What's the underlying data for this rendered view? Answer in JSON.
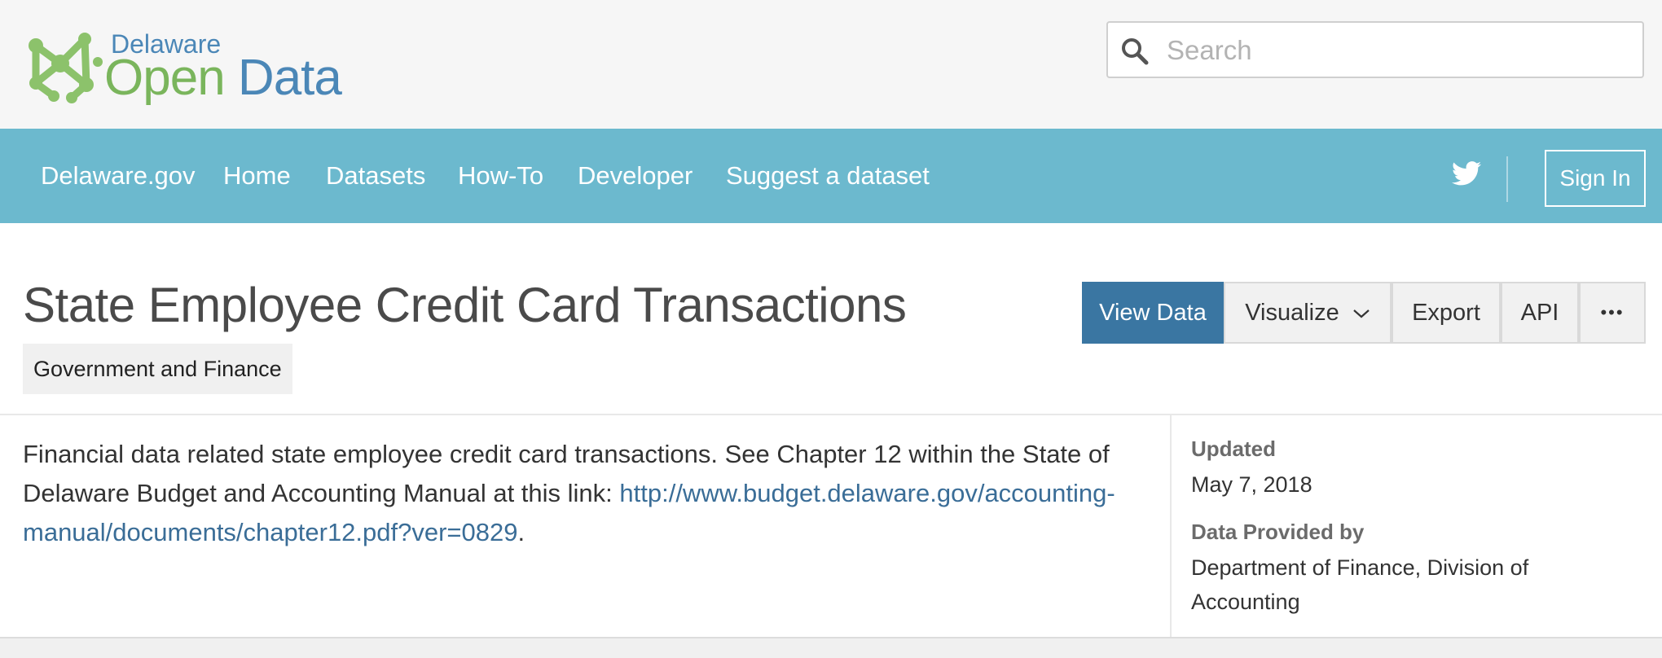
{
  "logo": {
    "small_text": "Delaware",
    "big_text_o": "O",
    "big_text_pen": "pen",
    "big_text_data": " Data",
    "colors": {
      "green": "#7ab55c",
      "blue": "#4b87b7"
    }
  },
  "search": {
    "placeholder": "Search",
    "value": ""
  },
  "nav": {
    "items": [
      "Delaware.gov",
      "Home",
      "Datasets",
      "How-To",
      "Developer",
      "Suggest a dataset"
    ],
    "sign_in": "Sign In",
    "background": "#6cb9ce"
  },
  "dataset": {
    "title": "State Employee Credit Card Transactions",
    "category": "Government and Finance",
    "actions": {
      "view_data": "View Data",
      "visualize": "Visualize",
      "export": "Export",
      "api": "API",
      "more": "•••"
    },
    "description_text": "Financial data related state employee credit card transactions. See Chapter 12 within the State of Delaware Budget and Accounting Manual at this link: ",
    "description_link": "http://www.budget.delaware.gov/accounting-manual/documents/chapter12.pdf?ver=0829",
    "description_end": "."
  },
  "meta": {
    "updated_label": "Updated",
    "updated_value": "May 7, 2018",
    "provider_label": "Data Provided by",
    "provider_value": "Department of Finance, Division of Accounting"
  },
  "colors": {
    "primary": "#3a76a2",
    "link": "#3a6d97"
  }
}
